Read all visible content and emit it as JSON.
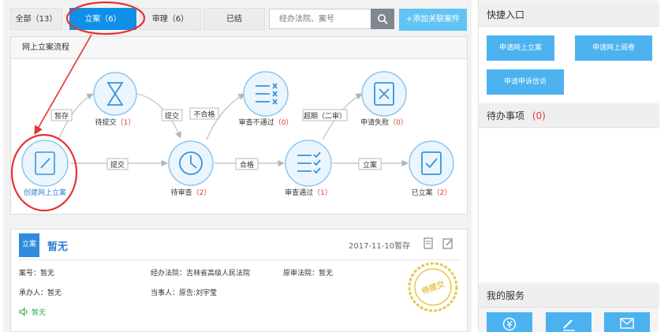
{
  "tabs": {
    "all": "全部（13）",
    "case": "立案（6）",
    "review": "审理（6）",
    "closed": "已结"
  },
  "search": {
    "placeholder": "经办法院、案号"
  },
  "add_button": "+添加关联案件",
  "flow": {
    "title": "网上立案流程",
    "nodes": {
      "create": "创建网上立案",
      "pending_submit": "待提交",
      "pending_submit_count": "（1）",
      "pending_review": "待审查",
      "pending_review_count": "（2）",
      "review_fail": "审查不通过",
      "review_fail_count": "（0）",
      "review_pass": "审查通过",
      "review_pass_count": "（1）",
      "apply_fail": "申请失败",
      "apply_fail_count": "（0）",
      "filed": "已立案",
      "filed_count": "（2）"
    },
    "edges": {
      "save": "暂存",
      "submit1": "提交",
      "submit2": "提交",
      "unqualified": "不合格",
      "qualified": "合格",
      "overdue": "超期（二审）",
      "file": "立案"
    }
  },
  "case": {
    "badge": "立案",
    "title": "暂无",
    "date": "2017-11-10暂存",
    "number": "案号：暂无",
    "court": "经办法院：吉林省高级人民法院",
    "orig_court": "原审法院：暂无",
    "handler": "承办人：暂无",
    "party": "当事人：原告:刘宇莹",
    "notice": "暂无",
    "stamp": "待提交"
  },
  "sidebar": {
    "quick_title": "快捷入口",
    "quick": {
      "online_case": "申请网上立案",
      "online_read": "申请网上阅卷",
      "petition": "申请申诉信访"
    },
    "todo_title": "待办事项",
    "todo_count": "(0)",
    "services_title": "我的服务"
  },
  "colors": {
    "primary": "#0f8fe8",
    "node_blue": "#3a95d9",
    "count_red": "#e23b2e",
    "annotation_red": "#e53232",
    "stamp_gold": "#e7c84b"
  }
}
